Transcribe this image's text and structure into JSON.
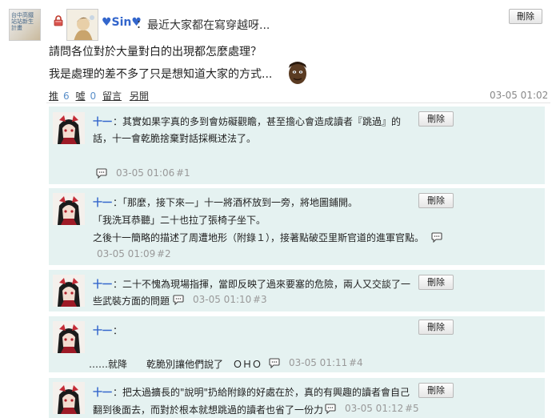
{
  "post": {
    "group_avatar_text": [
      "台中高鐵",
      "站站新生",
      "計畫"
    ],
    "author": "♥Sin♥",
    "colon": "：",
    "title": "最近大家都在寫穿越呀...",
    "delete_label": "刪除",
    "body_line1": "請問各位對於大量對白的出現都怎麼處理？",
    "body_line2": "我是處理的差不多了只是想知道大家的方式...",
    "push_label": "推",
    "push_count": "6",
    "boo_label": "噓",
    "boo_count": "0",
    "reply_label": "留言",
    "other_label": "另開",
    "time": "03-05 01:02"
  },
  "comments": [
    {
      "author": "十一",
      "line1": "：其實如果字真的多到會妨礙觀瞻，甚至擔心會造成讀者『跳過』的",
      "line2": "話，十一會乾脆捨棄對話採概述法了。",
      "time": "03-05 01:06",
      "floor": "#1",
      "delete_label": "刪除"
    },
    {
      "author": "十一",
      "line1": "：「那麼，接下來—」十一將酒杯放到一旁，將地圖鋪開。",
      "line2": "「我洗耳恭聽」二十也拉了張椅子坐下。",
      "line3": "之後十一簡略的描述了周遭地形（附錄１），接著點破亞里斯官道的進軍官點。",
      "time": "03-05 01:09",
      "floor": "#2",
      "delete_label": "刪除"
    },
    {
      "author": "十一",
      "line1": "：二十不愧為現場指揮，當即反映了過來要塞的危險，兩人又交談了一",
      "line2": "些武裝方面的問題",
      "time": "03-05 01:10",
      "floor": "#3",
      "delete_label": "刪除"
    },
    {
      "author": "十一",
      "line1": "：",
      "line2": "……就降　　乾脆別讓他們說了　ＯＨＯ",
      "time": "03-05 01:11",
      "floor": "#4",
      "delete_label": "刪除"
    },
    {
      "author": "十一",
      "line1": "：把太過擴長的\"說明\"扔給附錄的好處在於，真的有興趣的讀者會自己",
      "line2": "翻到後面去，而對於根本就想跳過的讀者也省了一份力",
      "time": "03-05 01:12",
      "floor": "#5",
      "delete_label": "刪除"
    }
  ]
}
